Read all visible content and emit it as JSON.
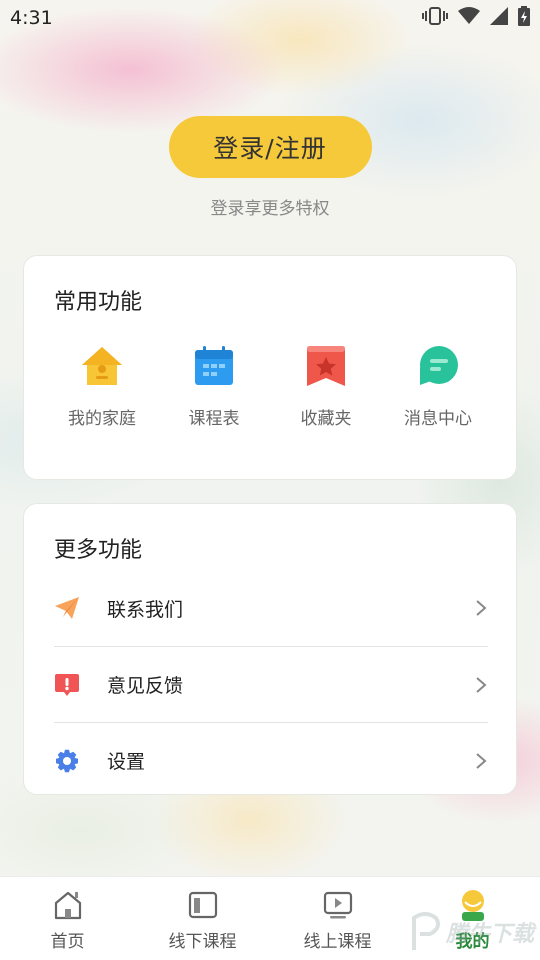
{
  "status_bar": {
    "time": "4:31",
    "icons": [
      "vibrate-icon",
      "wifi-icon",
      "signal-icon",
      "battery-icon"
    ]
  },
  "login": {
    "button_label": "登录/注册",
    "subtitle": "登录享更多特权"
  },
  "common_functions": {
    "title": "常用功能",
    "items": [
      {
        "label": "我的家庭",
        "icon": "home-icon",
        "color": "#f8c537"
      },
      {
        "label": "课程表",
        "icon": "calendar-icon",
        "color": "#2d9cf0"
      },
      {
        "label": "收藏夹",
        "icon": "bookmark-star-icon",
        "color": "#f0574b"
      },
      {
        "label": "消息中心",
        "icon": "message-icon",
        "color": "#29c39b"
      }
    ]
  },
  "more_functions": {
    "title": "更多功能",
    "items": [
      {
        "label": "联系我们",
        "icon": "paper-plane-icon",
        "color": "#f7a35c"
      },
      {
        "label": "意见反馈",
        "icon": "feedback-alert-icon",
        "color": "#f05454"
      },
      {
        "label": "设置",
        "icon": "gear-icon",
        "color": "#4a7fe8"
      }
    ]
  },
  "tabbar": {
    "items": [
      {
        "label": "首页",
        "icon": "home-outline-icon",
        "active": false
      },
      {
        "label": "线下课程",
        "icon": "offline-course-icon",
        "active": false
      },
      {
        "label": "线上课程",
        "icon": "online-course-icon",
        "active": false
      },
      {
        "label": "我的",
        "icon": "profile-avatar-icon",
        "active": true
      }
    ]
  },
  "colors": {
    "accent": "#f6c93b",
    "active_tab": "#2a8a3a"
  },
  "watermark": {
    "text": "腾牛下载"
  }
}
